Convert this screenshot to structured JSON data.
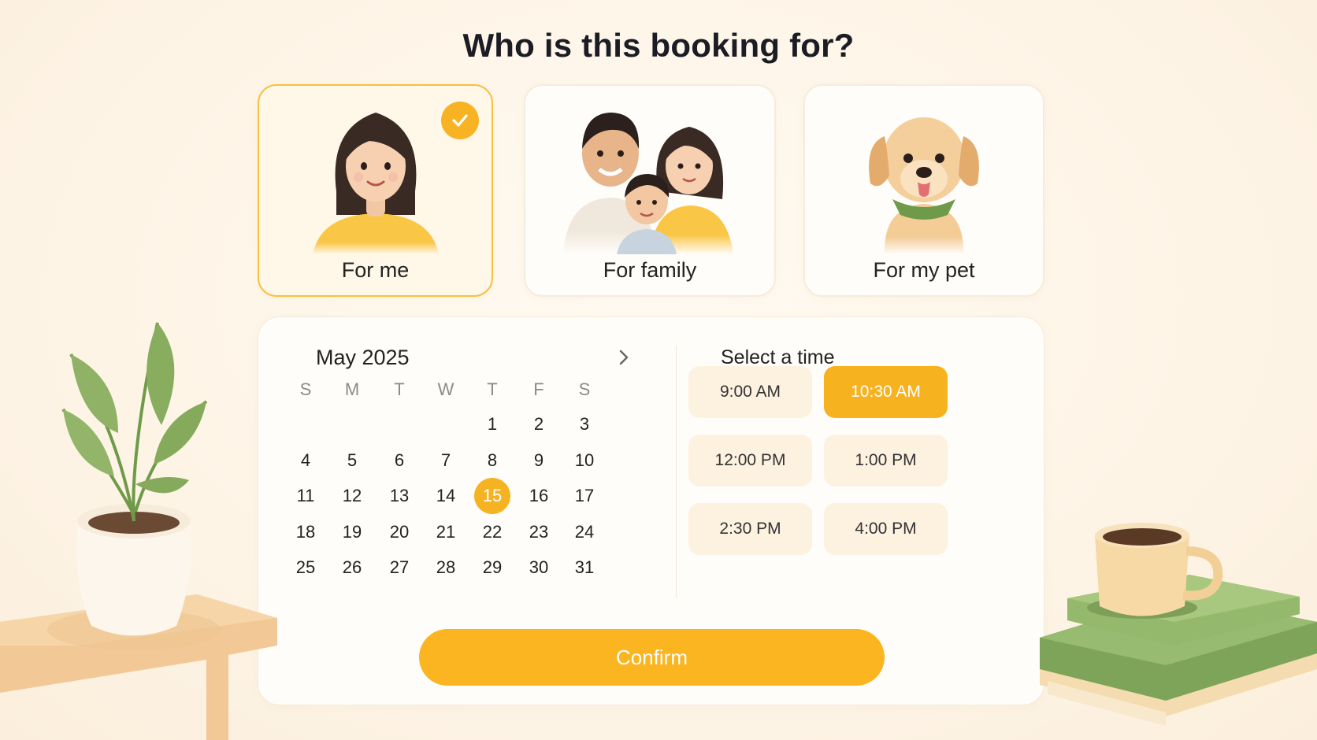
{
  "heading": "Who is this booking for?",
  "options": [
    {
      "label": "For me",
      "selected": true
    },
    {
      "label": "For family",
      "selected": false
    },
    {
      "label": "For my pet",
      "selected": false
    }
  ],
  "calendar": {
    "month_label": "May 2025",
    "weekdays": [
      "S",
      "M",
      "T",
      "W",
      "T",
      "F",
      "S"
    ],
    "first_weekday_index": 4,
    "days_in_month": 31,
    "selected_day": 15
  },
  "time": {
    "title": "Select a time",
    "slots": [
      "9:00 AM",
      "10:30 AM",
      "12:00 PM",
      "1:00 PM",
      "2:30 PM",
      "4:00 PM"
    ],
    "selected": "10:30 AM"
  },
  "confirm_label": "Confirm",
  "icons": {
    "check": "check-icon",
    "next": "chevron-right-icon"
  },
  "colors": {
    "accent": "#F7B324",
    "selected_card_border": "#F7C13F",
    "slot_bg": "#FDF1E0"
  }
}
